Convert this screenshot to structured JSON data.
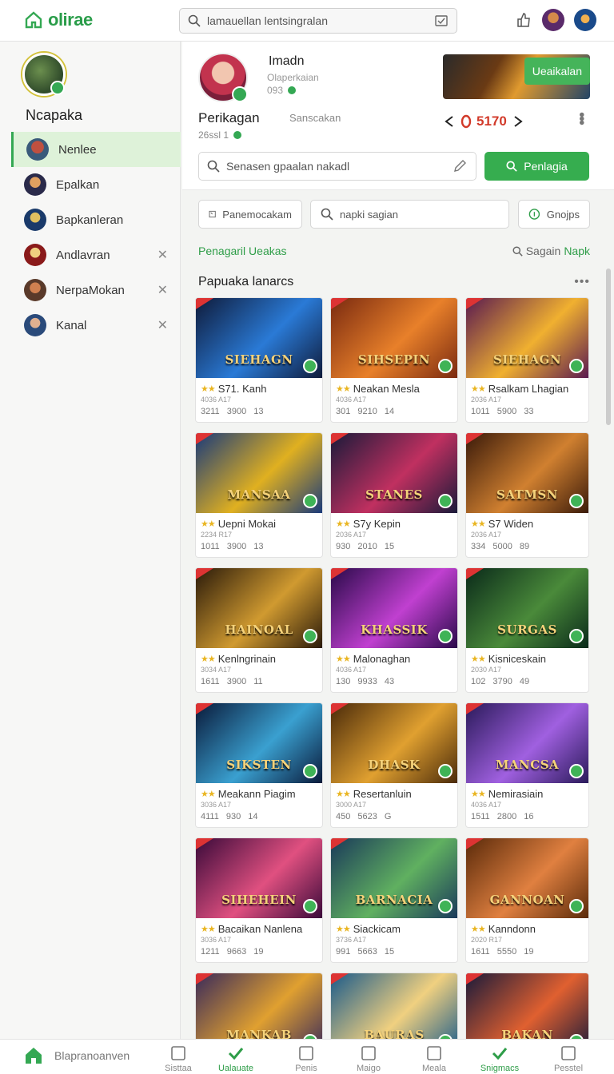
{
  "topbar": {
    "logo": "olirae",
    "search_text": "lamauellan lentsingralan"
  },
  "sidebar": {
    "name": "Ncapaka",
    "items": [
      {
        "label": "Nenlee",
        "active": true,
        "closable": false
      },
      {
        "label": "Epalkan",
        "active": false,
        "closable": false
      },
      {
        "label": "Bapkanleran",
        "active": false,
        "closable": false
      },
      {
        "label": "Andlavran",
        "active": false,
        "closable": true
      },
      {
        "label": "NerpaMokan",
        "active": false,
        "closable": true
      },
      {
        "label": "Kanal",
        "active": false,
        "closable": true
      }
    ]
  },
  "profile": {
    "name": "Imadn",
    "sub": "Olaperkaian",
    "num": "093",
    "banner_button": "Ueaikalan",
    "title": "Perikagan",
    "sans": "Sanscakan",
    "count": "26ssl 1",
    "score": "5170",
    "search_placeholder": "Senasen gpaalan nakadl",
    "search_button": "Penlagia"
  },
  "filters": {
    "chip1": "Panemocakam",
    "chip2": "napki sagian",
    "chip3": "Gnojps"
  },
  "section": {
    "left": "Penagaril Ueakas",
    "right_a": "Sagain",
    "right_b": "Napk"
  },
  "list_title": "Papuaka lanarcs",
  "games": [
    {
      "art": "SIEHAGN",
      "title": "S71. Kanh",
      "meta": "4036 A17",
      "stats": "3211 3900 13",
      "c1": "#0f1b3a",
      "c2": "#2a7ad6"
    },
    {
      "art": "SIHSEPIN",
      "title": "Neakan Mesla",
      "meta": "4036 A17",
      "stats": "301 9210 14",
      "c1": "#7a2a10",
      "c2": "#e8802a"
    },
    {
      "art": "SIEHAGN",
      "title": "Rsalkam Lhagian",
      "meta": "2036 A17",
      "stats": "1011 5900 33",
      "c1": "#5a1a50",
      "c2": "#f0b030"
    },
    {
      "art": "MANSAA",
      "title": "Uepni Mokai",
      "meta": "2234 R17",
      "stats": "1011 3900 13",
      "c1": "#1a3a7a",
      "c2": "#e0b020"
    },
    {
      "art": "STANES",
      "title": "S7y Kepin",
      "meta": "2036 A17",
      "stats": "930 2010 15",
      "c1": "#1a1a3a",
      "c2": "#c03060"
    },
    {
      "art": "SATMSN",
      "title": "S7 Widen",
      "meta": "2036 A17",
      "stats": "334 5000 89",
      "c1": "#3a1a0a",
      "c2": "#d08030"
    },
    {
      "art": "HAINOAL",
      "title": "Kenlngrinain",
      "meta": "3034 A17",
      "stats": "1611 3900 11",
      "c1": "#2a1a0a",
      "c2": "#d09a30"
    },
    {
      "art": "KHASSIK",
      "title": "Malonaghan",
      "meta": "4036 A17",
      "stats": "130 9933 43",
      "c1": "#2a0a4a",
      "c2": "#c040d0"
    },
    {
      "art": "SURGAS",
      "title": "Kisniceskain",
      "meta": "2030 A17",
      "stats": "102 3790 49",
      "c1": "#0a2a1a",
      "c2": "#4a8a3a"
    },
    {
      "art": "SIKSTEN",
      "title": "Meakann Piagim",
      "meta": "3036 A17",
      "stats": "4111 930 14",
      "c1": "#0a1a3a",
      "c2": "#3aa0d0"
    },
    {
      "art": "DHASK",
      "title": "Resertanluin",
      "meta": "3000 A17",
      "stats": "450 5623 G",
      "c1": "#4a2a0a",
      "c2": "#e0a030"
    },
    {
      "art": "MANCSA",
      "title": "Nemirasiain",
      "meta": "4036 A17",
      "stats": "1511 2800 16",
      "c1": "#2a1a5a",
      "c2": "#a060e0"
    },
    {
      "art": "SIHEHEIN",
      "title": "Bacaikan Nanlena",
      "meta": "3036 A17",
      "stats": "1211 9663 19",
      "c1": "#3a0a3a",
      "c2": "#e05080"
    },
    {
      "art": "BARNACIA",
      "title": "Siackicam",
      "meta": "3736 A17",
      "stats": "991 5663 15",
      "c1": "#1a3a5a",
      "c2": "#60b060"
    },
    {
      "art": "GANNOAN",
      "title": "Kanndonn",
      "meta": "2020 R17",
      "stats": "1611 5550 19",
      "c1": "#5a2a0a",
      "c2": "#e08040"
    },
    {
      "art": "MANKAB",
      "title": "",
      "meta": "",
      "stats": "",
      "c1": "#3a2a5a",
      "c2": "#e0a030"
    },
    {
      "art": "BAURAS",
      "title": "",
      "meta": "",
      "stats": "",
      "c1": "#1a5a8a",
      "c2": "#f0d080"
    },
    {
      "art": "BAKAN",
      "title": "",
      "meta": "",
      "stats": "",
      "c1": "#1a1a3a",
      "c2": "#e06030"
    }
  ],
  "bottomnav": {
    "home": "Blapranoanven",
    "items": [
      {
        "label": "Sisttaa",
        "on": false
      },
      {
        "label": "Ualauate",
        "on": true
      },
      {
        "label": "Penis",
        "on": false
      },
      {
        "label": "Maigo",
        "on": false
      },
      {
        "label": "Meala",
        "on": false
      },
      {
        "label": "Snigmacs",
        "on": true
      },
      {
        "label": "Pesstel",
        "on": false
      }
    ]
  }
}
